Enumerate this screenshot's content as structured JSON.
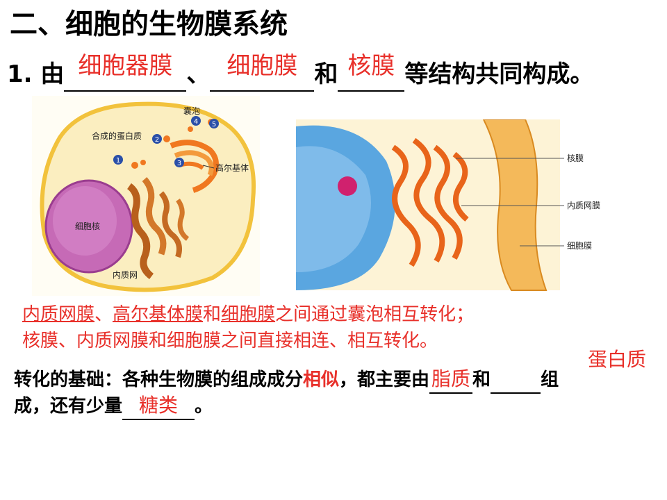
{
  "title": "二、细胞的生物膜系统",
  "line1": {
    "prefix": "1. 由",
    "answer1": "细胞器膜",
    "sep1": "、",
    "answer2": "细胞膜",
    "sep2": "和",
    "answer3": "核膜",
    "suffix": "等结构共同构成。"
  },
  "figure_left": {
    "labels": {
      "vesicle": "囊泡",
      "synth_protein": "合成的蛋白质",
      "golgi": "高尔基体",
      "nucleus": "细胞核",
      "er": "内质网"
    },
    "steps": [
      "1",
      "2",
      "3",
      "4",
      "5"
    ]
  },
  "figure_right": {
    "labels": {
      "nuclear_membrane": "核膜",
      "er_membrane": "内质网膜",
      "cell_membrane": "细胞膜"
    }
  },
  "conversion": {
    "l1_a": "内质网膜",
    "l1_b": "、",
    "l1_c": "高尔基体膜",
    "l1_d": "和",
    "l1_e": "细胞膜",
    "l1_f": "之间通过囊泡相互转化；",
    "l2": "核膜、内质网膜和细胞膜之间直接相连、相互转化。"
  },
  "basis": {
    "a": "转化的基础：各种生物膜的组成成分",
    "similar": "相似",
    "b": "，都主要由",
    "ans_lipid": "脂质",
    "c": "和",
    "ans_protein": "蛋白质",
    "d": "组",
    "e": "成，还有少量",
    "ans_sugar": "糖类",
    "f": "。"
  },
  "colors": {
    "answer_red": "#e8302a"
  }
}
